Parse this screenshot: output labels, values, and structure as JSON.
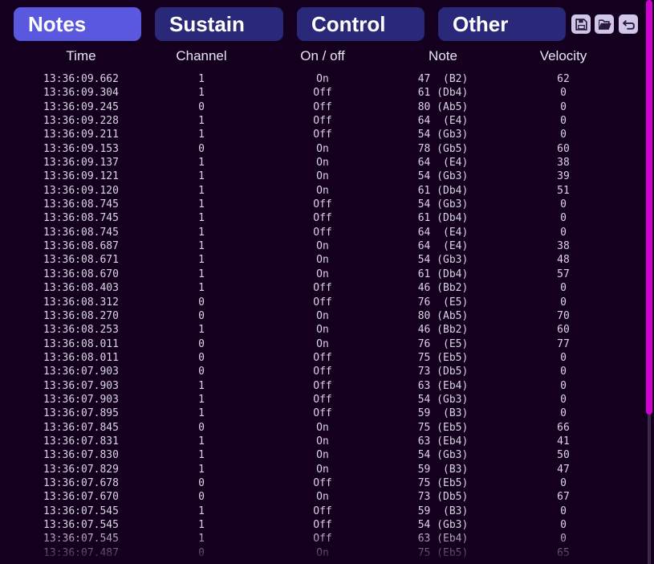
{
  "tabs": [
    {
      "label": "Notes",
      "active": true
    },
    {
      "label": "Sustain",
      "active": false
    },
    {
      "label": "Control",
      "active": false
    },
    {
      "label": "Other",
      "active": false
    }
  ],
  "toolbar": {
    "save_icon": "save-icon",
    "open_icon": "folder-open-icon",
    "back_icon": "undo-arrow-icon"
  },
  "columns": [
    "Time",
    "Channel",
    "On / off",
    "Note",
    "Velocity"
  ],
  "rows": [
    {
      "time": "13:36:09.662",
      "channel": "1",
      "state": "On",
      "note": "47  (B2)",
      "velocity": "62"
    },
    {
      "time": "13:36:09.304",
      "channel": "1",
      "state": "Off",
      "note": "61 (Db4)",
      "velocity": "0"
    },
    {
      "time": "13:36:09.245",
      "channel": "0",
      "state": "Off",
      "note": "80 (Ab5)",
      "velocity": "0"
    },
    {
      "time": "13:36:09.228",
      "channel": "1",
      "state": "Off",
      "note": "64  (E4)",
      "velocity": "0"
    },
    {
      "time": "13:36:09.211",
      "channel": "1",
      "state": "Off",
      "note": "54 (Gb3)",
      "velocity": "0"
    },
    {
      "time": "13:36:09.153",
      "channel": "0",
      "state": "On",
      "note": "78 (Gb5)",
      "velocity": "60"
    },
    {
      "time": "13:36:09.137",
      "channel": "1",
      "state": "On",
      "note": "64  (E4)",
      "velocity": "38"
    },
    {
      "time": "13:36:09.121",
      "channel": "1",
      "state": "On",
      "note": "54 (Gb3)",
      "velocity": "39"
    },
    {
      "time": "13:36:09.120",
      "channel": "1",
      "state": "On",
      "note": "61 (Db4)",
      "velocity": "51"
    },
    {
      "time": "13:36:08.745",
      "channel": "1",
      "state": "Off",
      "note": "54 (Gb3)",
      "velocity": "0"
    },
    {
      "time": "13:36:08.745",
      "channel": "1",
      "state": "Off",
      "note": "61 (Db4)",
      "velocity": "0"
    },
    {
      "time": "13:36:08.745",
      "channel": "1",
      "state": "Off",
      "note": "64  (E4)",
      "velocity": "0"
    },
    {
      "time": "13:36:08.687",
      "channel": "1",
      "state": "On",
      "note": "64  (E4)",
      "velocity": "38"
    },
    {
      "time": "13:36:08.671",
      "channel": "1",
      "state": "On",
      "note": "54 (Gb3)",
      "velocity": "48"
    },
    {
      "time": "13:36:08.670",
      "channel": "1",
      "state": "On",
      "note": "61 (Db4)",
      "velocity": "57"
    },
    {
      "time": "13:36:08.403",
      "channel": "1",
      "state": "Off",
      "note": "46 (Bb2)",
      "velocity": "0"
    },
    {
      "time": "13:36:08.312",
      "channel": "0",
      "state": "Off",
      "note": "76  (E5)",
      "velocity": "0"
    },
    {
      "time": "13:36:08.270",
      "channel": "0",
      "state": "On",
      "note": "80 (Ab5)",
      "velocity": "70"
    },
    {
      "time": "13:36:08.253",
      "channel": "1",
      "state": "On",
      "note": "46 (Bb2)",
      "velocity": "60"
    },
    {
      "time": "13:36:08.011",
      "channel": "0",
      "state": "On",
      "note": "76  (E5)",
      "velocity": "77"
    },
    {
      "time": "13:36:08.011",
      "channel": "0",
      "state": "Off",
      "note": "75 (Eb5)",
      "velocity": "0"
    },
    {
      "time": "13:36:07.903",
      "channel": "0",
      "state": "Off",
      "note": "73 (Db5)",
      "velocity": "0"
    },
    {
      "time": "13:36:07.903",
      "channel": "1",
      "state": "Off",
      "note": "63 (Eb4)",
      "velocity": "0"
    },
    {
      "time": "13:36:07.903",
      "channel": "1",
      "state": "Off",
      "note": "54 (Gb3)",
      "velocity": "0"
    },
    {
      "time": "13:36:07.895",
      "channel": "1",
      "state": "Off",
      "note": "59  (B3)",
      "velocity": "0"
    },
    {
      "time": "13:36:07.845",
      "channel": "0",
      "state": "On",
      "note": "75 (Eb5)",
      "velocity": "66"
    },
    {
      "time": "13:36:07.831",
      "channel": "1",
      "state": "On",
      "note": "63 (Eb4)",
      "velocity": "41"
    },
    {
      "time": "13:36:07.830",
      "channel": "1",
      "state": "On",
      "note": "54 (Gb3)",
      "velocity": "50"
    },
    {
      "time": "13:36:07.829",
      "channel": "1",
      "state": "On",
      "note": "59  (B3)",
      "velocity": "47"
    },
    {
      "time": "13:36:07.678",
      "channel": "0",
      "state": "Off",
      "note": "75 (Eb5)",
      "velocity": "0"
    },
    {
      "time": "13:36:07.670",
      "channel": "0",
      "state": "On",
      "note": "73 (Db5)",
      "velocity": "67"
    },
    {
      "time": "13:36:07.545",
      "channel": "1",
      "state": "Off",
      "note": "59  (B3)",
      "velocity": "0"
    },
    {
      "time": "13:36:07.545",
      "channel": "1",
      "state": "Off",
      "note": "54 (Gb3)",
      "velocity": "0"
    },
    {
      "time": "13:36:07.545",
      "channel": "1",
      "state": "Off",
      "note": "63 (Eb4)",
      "velocity": "0"
    },
    {
      "time": "13:36:07.487",
      "channel": "0",
      "state": "On",
      "note": "75 (Eb5)",
      "velocity": "65"
    }
  ],
  "colors": {
    "background": "#14001e",
    "tab_active": "#5b58e0",
    "tab_inactive": "#2a2878",
    "scrollbar_thumb": "#d000d0",
    "text": "#d8d6e2"
  }
}
